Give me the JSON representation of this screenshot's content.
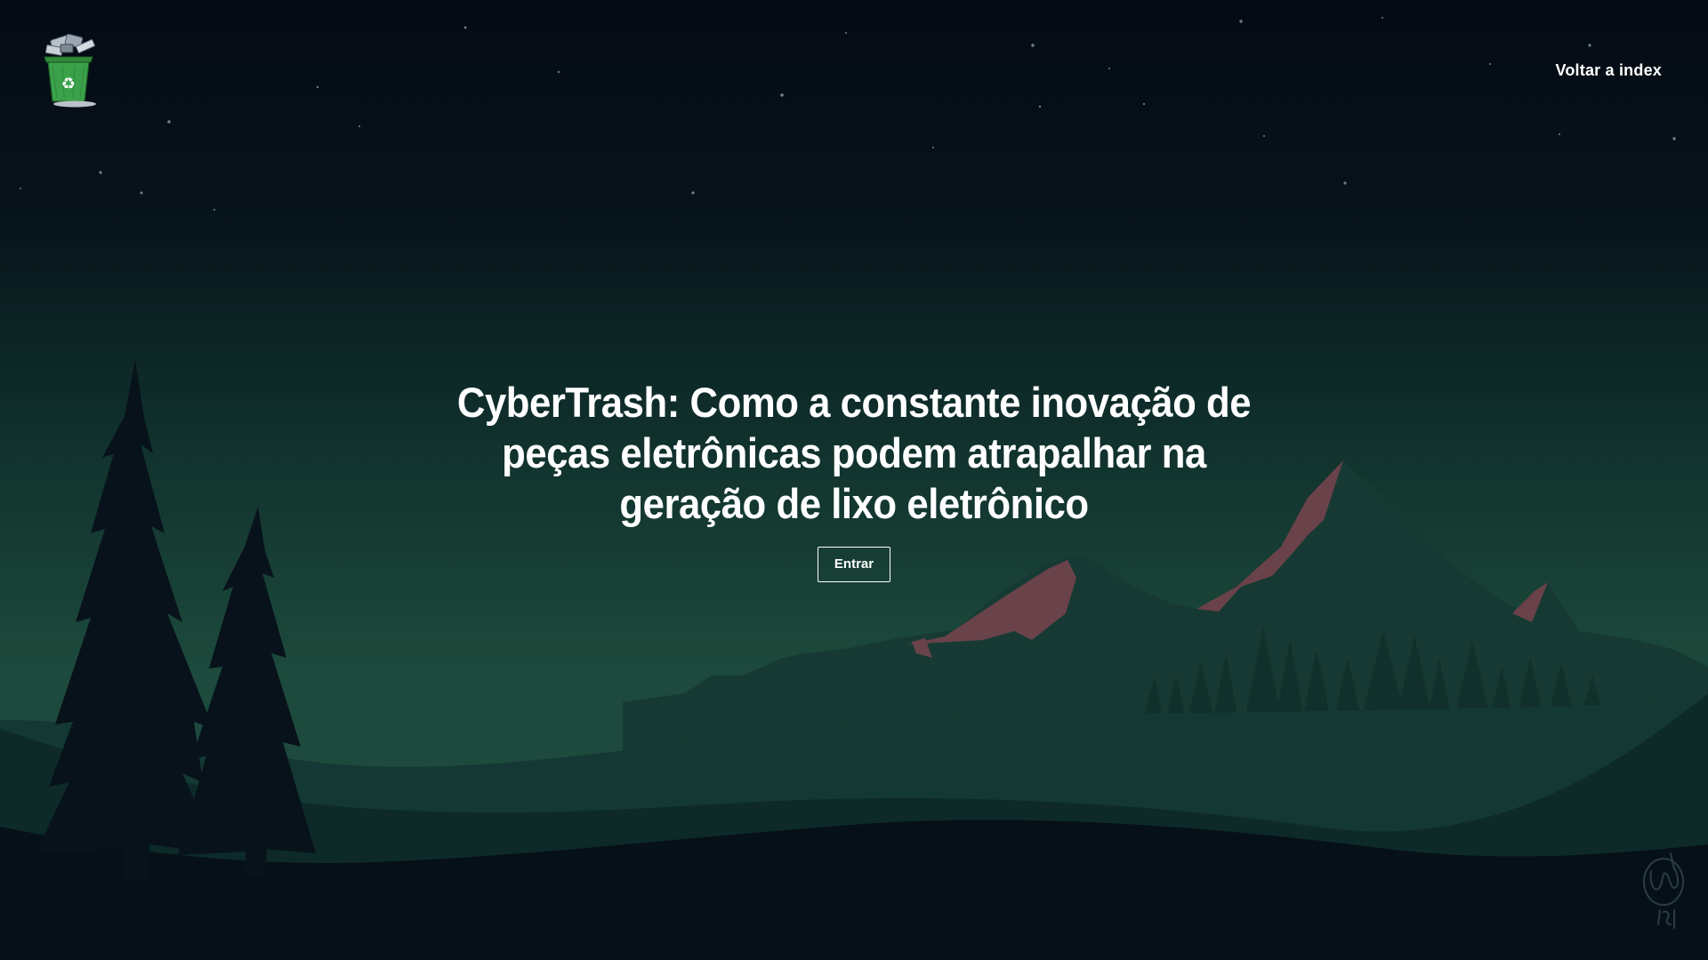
{
  "nav": {
    "logo_icon": "recycle-trash-bin-icon",
    "back_label": "Voltar a index"
  },
  "hero": {
    "title": "CyberTrash: Como a constante inovação de peças eletrônicas podem atrapalhar na geração de lixo eletrônico",
    "enter_label": "Entrar"
  },
  "background": {
    "description_icon": "night-mountain-landscape",
    "sky_top": "#040a14",
    "sky_bottom": "#1d4a3c",
    "mountain_color": "#163a33",
    "mountain_peak_color": "#6a4249",
    "tree_color": "#07121a",
    "signature_icon": "artist-signature-icon"
  }
}
